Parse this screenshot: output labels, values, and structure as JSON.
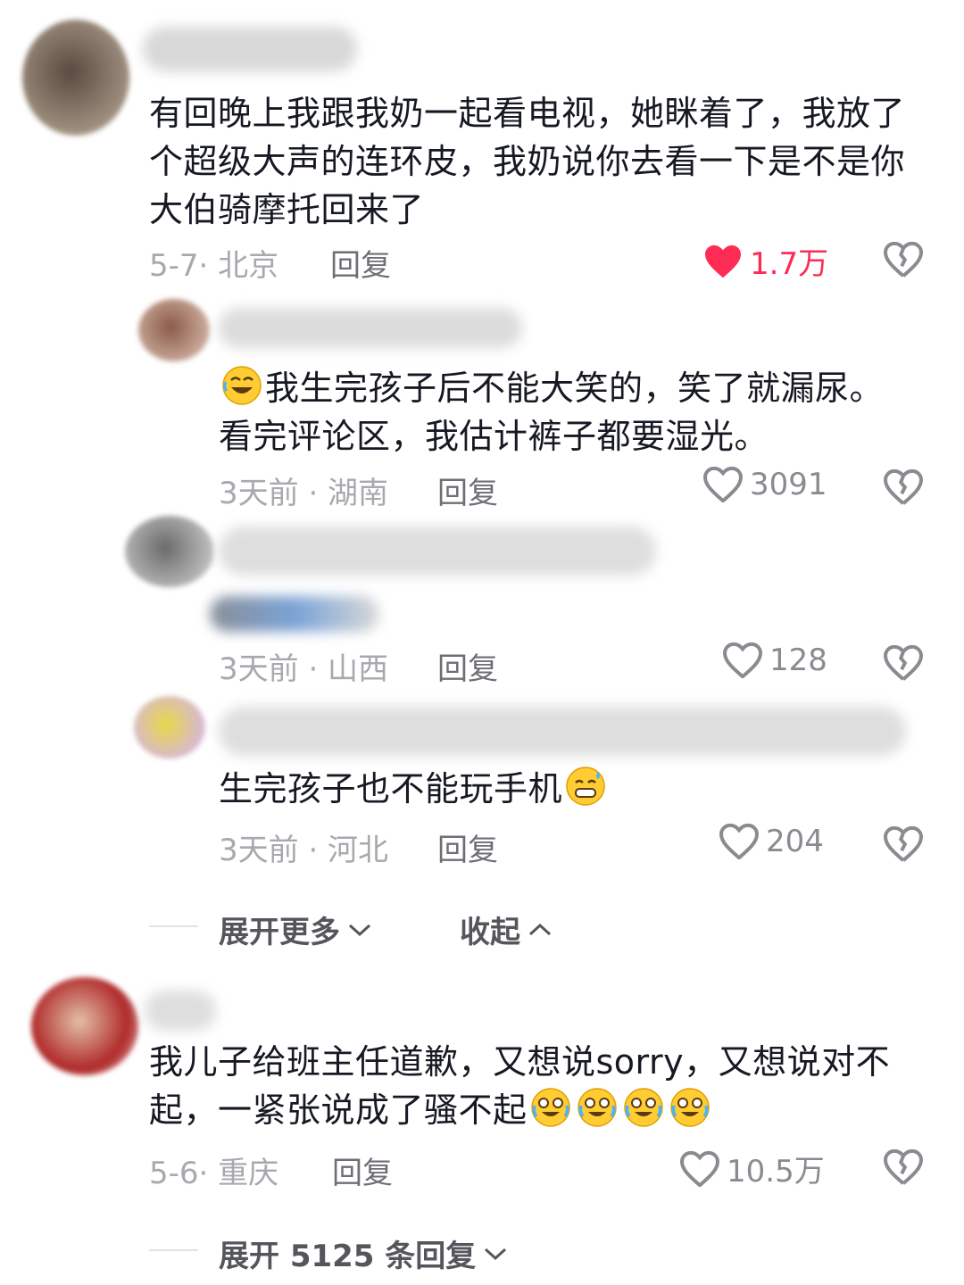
{
  "comments": [
    {
      "text": "有回晚上我跟我奶一起看电视，她眯着了，我放了个超级大声的连环皮，我奶说你去看一下是不是你大伯骑摩托回来了",
      "meta": "5-7· 北京",
      "reply": "回复",
      "likes": "1.7万"
    },
    {
      "text": "我生完孩子后不能大笑的，笑了就漏尿。看完评论区，我估计裤子都要湿光。",
      "meta": "3天前 · 湖南",
      "reply": "回复",
      "likes": "3091"
    },
    {
      "meta": "3天前 · 山西",
      "reply": "回复",
      "likes": "128"
    },
    {
      "text": "生完孩子也不能玩手机",
      "meta": "3天前 · 河北",
      "reply": "回复",
      "likes": "204"
    },
    {
      "text": "我儿子给班主任道歉，又想说sorry，又想说对不起，一紧张说成了骚不起",
      "meta": "5-6· 重庆",
      "reply": "回复",
      "likes": "10.5万"
    }
  ],
  "controls": {
    "expand_more": "展开更多",
    "collapse": "收起",
    "expand_replies": "展开 5125 条回复"
  },
  "icons": {
    "like": "heart-icon",
    "dislike": "broken-heart-icon",
    "emoji": "laughing-emoji-icon"
  },
  "colors": {
    "liked": "#fe2c55",
    "text": "#161823",
    "meta": "#a8a9ae"
  }
}
